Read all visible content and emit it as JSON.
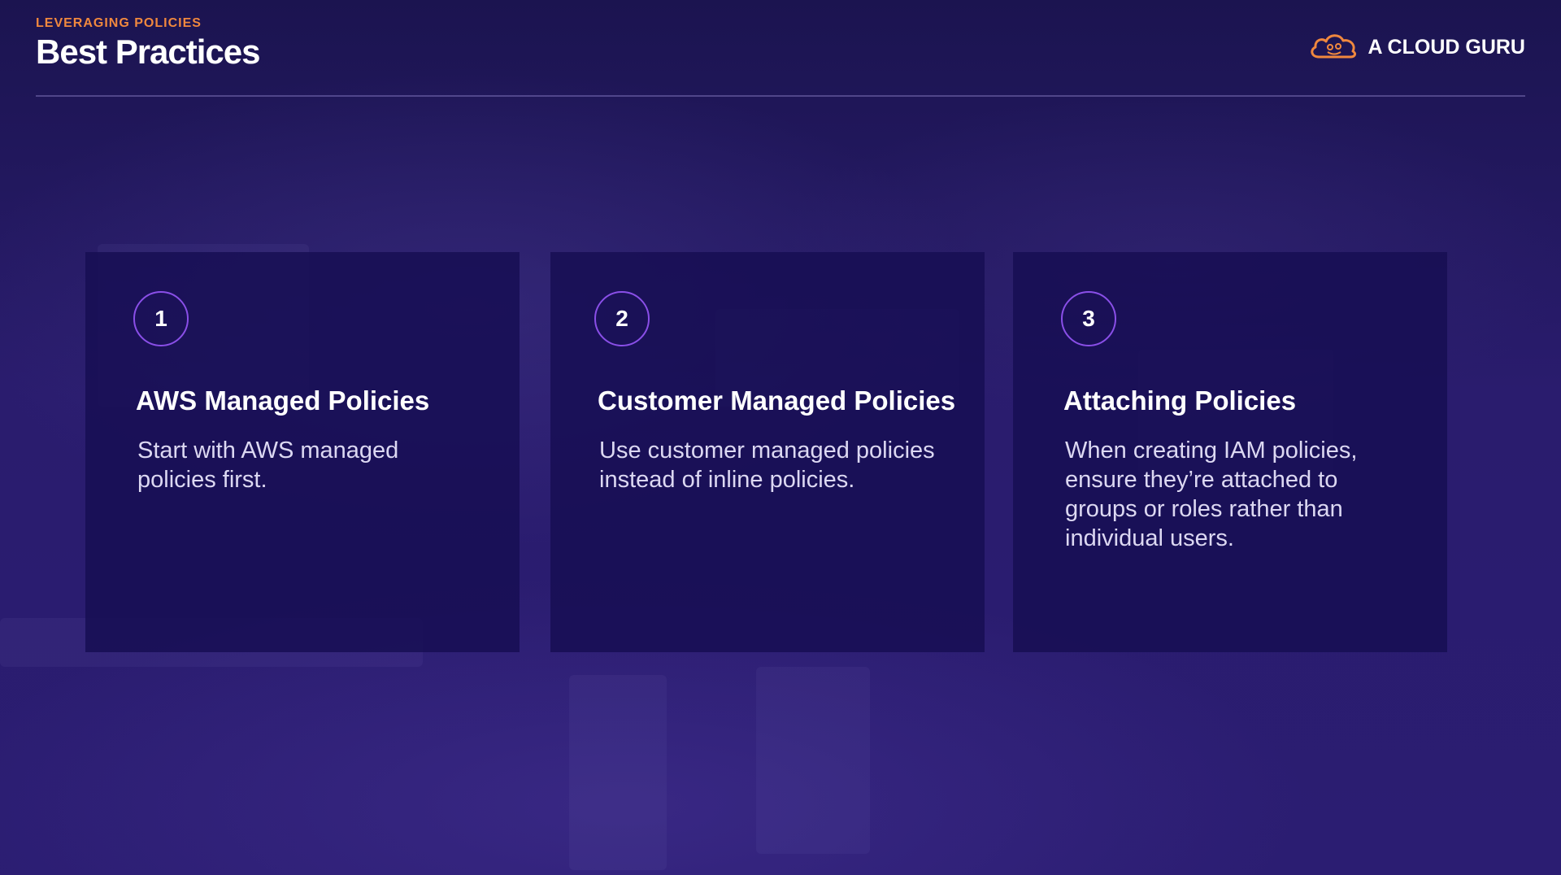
{
  "header": {
    "eyebrow": "LEVERAGING POLICIES",
    "title": "Best Practices"
  },
  "brand": {
    "name": "A CLOUD GURU",
    "icon": "cloud-logo-icon",
    "icon_color": "#f0883e"
  },
  "cards": [
    {
      "number": "1",
      "title": "AWS Managed Policies",
      "text": "Start with AWS managed policies first."
    },
    {
      "number": "2",
      "title": "Customer Managed Policies",
      "text": "Use customer managed policies instead of inline policies."
    },
    {
      "number": "3",
      "title": "Attaching Policies",
      "text": "When creating IAM policies, ensure they’re attached to groups or roles rather than individual users."
    }
  ],
  "colors": {
    "background": "#231760",
    "accent": "#f0883e",
    "circle_border": "#8a4fe8",
    "card_background": "#160e52"
  }
}
